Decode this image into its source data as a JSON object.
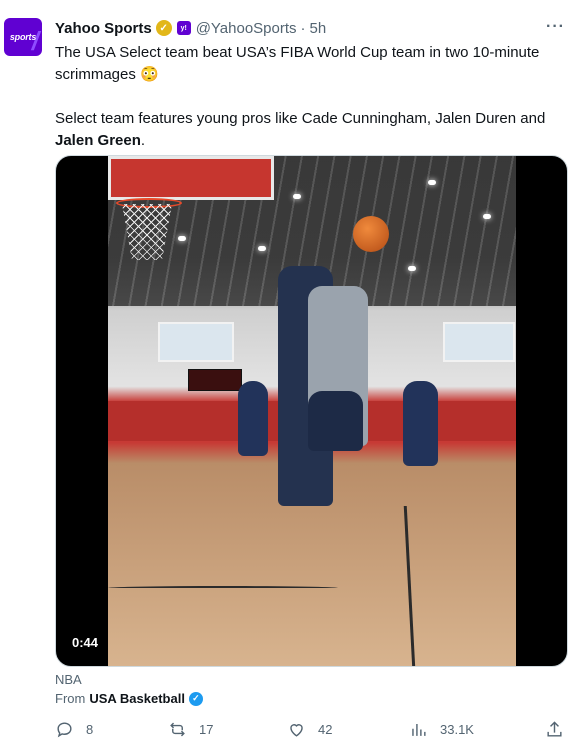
{
  "tweet": {
    "author_name": "Yahoo Sports",
    "avatar_text": "sports",
    "handle": "@YahooSports",
    "separator": "·",
    "time": "5h",
    "more_label": "···",
    "text_line1": "The USA Select team beat USA’s FIBA World Cup team in two 10-minute scrimmages 😳",
    "text_line2_prefix": "Select team features young pros like Cade Cunningham, Jalen Duren and",
    "text_line2_bold": "Jalen Green",
    "text_line2_suffix": "."
  },
  "media": {
    "duration": "0:44"
  },
  "attribution": {
    "source": "NBA",
    "from_label": "From",
    "from_account": "USA Basketball"
  },
  "actions": {
    "replies": "8",
    "reposts": "17",
    "likes": "42",
    "views": "33.1K"
  },
  "colors": {
    "brand_purple": "#6001d2",
    "verified_gold": "#e2b719",
    "verified_blue": "#1d9bf0",
    "secondary_text": "#536471"
  },
  "icons": [
    "reply-icon",
    "repost-icon",
    "like-icon",
    "views-icon",
    "share-icon",
    "verified-gold-icon",
    "verified-blue-icon",
    "more-icon"
  ]
}
